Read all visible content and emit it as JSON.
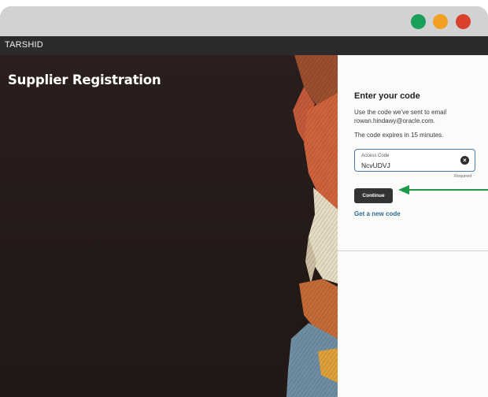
{
  "window": {
    "controls": [
      "green",
      "orange",
      "red"
    ]
  },
  "app_bar": {
    "brand": "TARSHID"
  },
  "hero": {
    "title": "Supplier Registration"
  },
  "panel": {
    "heading": "Enter your code",
    "description": "Use the code we've sent to email rowan.hindawy@oracle.com.",
    "expiry": "The code expires in 15 minutes.",
    "access_code": {
      "label": "Access Code",
      "value": "NcvUDVJ",
      "required": "Required"
    },
    "continue_label": "Continue",
    "new_code_link": "Get a new code"
  },
  "colors": {
    "accent_link": "#2d6a94",
    "arrow": "#1f9a4a",
    "field_border": "#4a7fb5"
  }
}
